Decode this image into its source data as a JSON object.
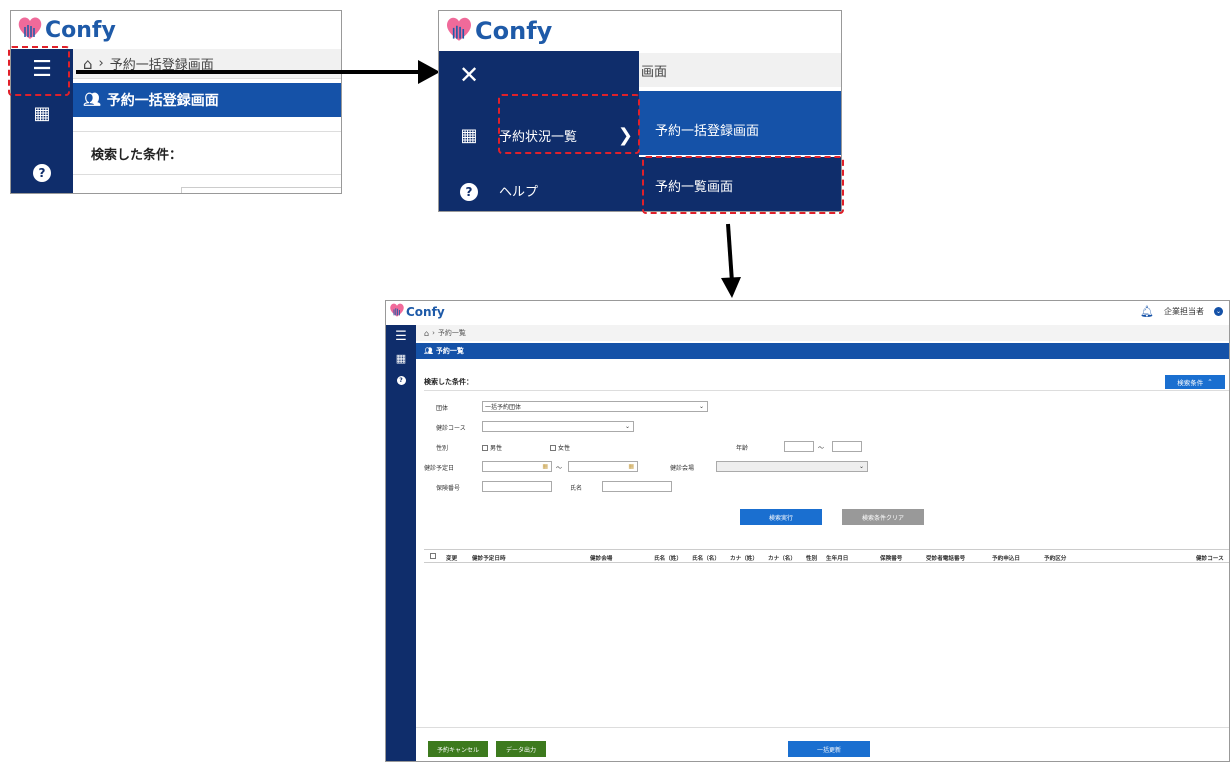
{
  "brand": {
    "name": "Confy"
  },
  "panel1": {
    "breadcrumb": "予約一括登録画面",
    "page_title": "予約一括登録画面",
    "search_conditions_label": "検索した条件："
  },
  "panel2": {
    "breadcrumb_partial": "画面",
    "menu": {
      "reservation_status": "予約状況一覧",
      "help": "ヘルプ",
      "submenu": [
        "予約一括登録画面",
        "予約一覧画面"
      ]
    }
  },
  "panel3": {
    "breadcrumb": "予約一覧",
    "page_title": "予約一覧",
    "user_label": "企業担当者",
    "search_conditions_label": "検索した条件：",
    "search_conditions_button": "検索条件",
    "form": {
      "group_label": "団体",
      "group_value": "一括予約団体",
      "course_label": "健診コース",
      "gender_label": "性別",
      "male": "男性",
      "female": "女性",
      "age_label": "年齢",
      "tilde": "～",
      "date_label": "健診予定日",
      "venue_label": "健診会場",
      "insurance_label": "保険番号",
      "name_label": "氏名"
    },
    "buttons": {
      "search": "検索実行",
      "clear": "検索条件クリア",
      "cancel": "予約キャンセル",
      "export": "データ出力",
      "bulk_update": "一括更新"
    },
    "table_headers": [
      "変更",
      "健診予定日時",
      "健診会場",
      "氏名（姓）",
      "氏名（名）",
      "カナ（姓）",
      "カナ（名）",
      "性別",
      "生年月日",
      "保険番号",
      "受診者電話番号",
      "予約申込日",
      "予約区分",
      "健診コース"
    ]
  },
  "colors": {
    "navy": "#0f2d6b",
    "blue": "#1552a8",
    "button_blue": "#1a6fd0",
    "green": "#3d7a1e",
    "dash_red": "#e0202a"
  }
}
